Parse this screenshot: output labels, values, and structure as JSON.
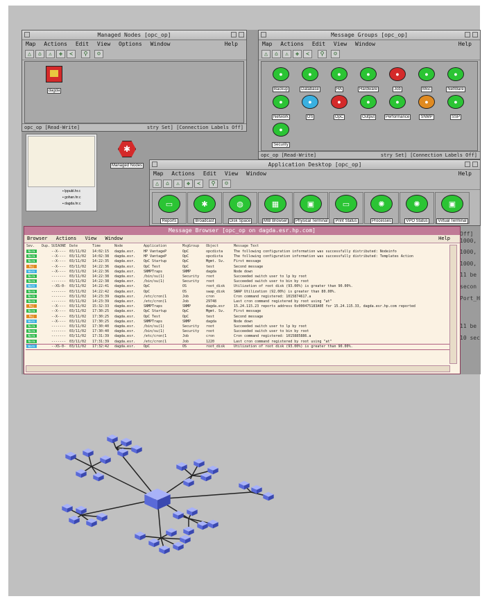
{
  "managed_nodes": {
    "title": "Managed Nodes [opc_op]",
    "menu": [
      "Map",
      "Actions",
      "Edit",
      "View",
      "Options",
      "Window"
    ],
    "help": "Help",
    "node_label": "dagda",
    "status_left": "opc_op [Read-Write]",
    "status_right": "stry Set] [Connection Labels Off]"
  },
  "message_groups": {
    "title": "Message Groups [opc_op]",
    "menu": [
      "Map",
      "Actions",
      "Edit",
      "View",
      "Window"
    ],
    "help": "Help",
    "groups": [
      {
        "label": "Backup",
        "color": "#2bc434"
      },
      {
        "label": "Database",
        "color": "#2bc434"
      },
      {
        "label": "HA",
        "color": "#2bc434"
      },
      {
        "label": "Hardware",
        "color": "#2bc434"
      },
      {
        "label": "Job",
        "color": "#d42a2a"
      },
      {
        "label": "Misc",
        "color": "#2bc434"
      },
      {
        "label": "NetWare",
        "color": "#2bc434"
      },
      {
        "label": "Network",
        "color": "#2bc434"
      },
      {
        "label": "OS",
        "color": "#3ab0e0"
      },
      {
        "label": "OpC",
        "color": "#d42a2a"
      },
      {
        "label": "Output",
        "color": "#2bc434"
      },
      {
        "label": "Performance",
        "color": "#2bc434"
      },
      {
        "label": "SNMP",
        "color": "#e08a20"
      },
      {
        "label": "SSP",
        "color": "#2bc434"
      },
      {
        "label": "Security",
        "color": "#2bc434"
      }
    ],
    "status_left": "opc_op [Read-Write]",
    "status_right": "stry Set] [Connection Labels Off]"
  },
  "side_panel": {
    "items": [
      "lppubl.hr.c",
      "gohan.hr.c",
      "dagda.hr.c"
    ],
    "managed_nodes_label": "Managed Nodes"
  },
  "app_desktop": {
    "title": "Application Desktop [opc_op]",
    "menu": [
      "Map",
      "Actions",
      "Edit",
      "View",
      "Window"
    ],
    "help": "Help",
    "apps": [
      "Reports",
      "Broadcast",
      "Disk Space",
      "MIB Browser",
      "Physical Terminal",
      "Print Status",
      "Processes",
      "VPO Status",
      "Virtual Terminal"
    ]
  },
  "message_browser": {
    "title": "Message Browser  [opc_op on dagda.esr.hp.com]",
    "menu": [
      "Browser",
      "Actions",
      "View",
      "Window"
    ],
    "help": "Help",
    "columns": [
      "Sev.",
      "Dup.",
      "SUIAONE",
      "Date",
      "Time",
      "Node",
      "Application",
      "MsgGroup",
      "Object",
      "Message Text"
    ],
    "rows": [
      {
        "sev": "Norm",
        "dup": "",
        "flags": "--X----",
        "date": "03/11/02",
        "time": "14:02:15",
        "node": "dagda.esr.",
        "app": "HP VantageP",
        "group": "OpC",
        "object": "opcdista",
        "text": "The following configuration information was successfully distributed:          Nodeinfo"
      },
      {
        "sev": "Norm",
        "dup": "",
        "flags": "--X----",
        "date": "03/11/02",
        "time": "14:02:38",
        "node": "dagda.esr.",
        "app": "HP VantageP",
        "group": "OpC",
        "object": "opcdista",
        "text": "The following configuration information was successfully distributed: Templates  Action"
      },
      {
        "sev": "Norm",
        "dup": "",
        "flags": "--X----",
        "date": "03/11/02",
        "time": "14:22:35",
        "node": "dagda.esr.",
        "app": "OpC Startup",
        "group": "OpC",
        "object": "Mgmt. Sv.",
        "text": "First message"
      },
      {
        "sev": "Maj",
        "dup": "",
        "flags": "--X----",
        "date": "03/11/02",
        "time": "14:22:36",
        "node": "dagda.esr.",
        "app": "OpC Test",
        "group": "OpC",
        "object": "test",
        "text": "Second message"
      },
      {
        "sev": "Warn",
        "dup": "",
        "flags": "--X----",
        "date": "03/11/02",
        "time": "14:22:36",
        "node": "dagda.esr.",
        "app": "SNMPTraps",
        "group": "SNMP",
        "object": "dagda",
        "text": "Node down"
      },
      {
        "sev": "Norm",
        "dup": "",
        "flags": "-------",
        "date": "03/11/02",
        "time": "14:22:38",
        "node": "dagda.esr.",
        "app": "/bin/su(1)",
        "group": "Security",
        "object": "root",
        "text": "Succeeded switch user to lp by root"
      },
      {
        "sev": "Norm",
        "dup": "",
        "flags": "-------",
        "date": "03/11/02",
        "time": "14:22:38",
        "node": "dagda.esr.",
        "app": "/bin/su(1)",
        "group": "Security",
        "object": "root",
        "text": "Succeeded switch user to bin by root"
      },
      {
        "sev": "Warn",
        "dup": "",
        "flags": "--XS-0-",
        "date": "03/11/02",
        "time": "14:22:41",
        "node": "dagda.esr.",
        "app": "OpC",
        "group": "OS",
        "object": "root_disk",
        "text": "Utilization of root disk (93.00%) is greater than 90.00%."
      },
      {
        "sev": "Norm",
        "dup": "",
        "flags": "-------",
        "date": "03/11/02",
        "time": "14:22:42",
        "node": "dagda.esr.",
        "app": "OpC",
        "group": "OS",
        "object": "swap_disk",
        "text": "SWAP Utilization (92.00%) is greater than 80.00%."
      },
      {
        "sev": "Norm",
        "dup": "",
        "flags": "-------",
        "date": "03/11/02",
        "time": "14:23:39",
        "node": "dagda.esr.",
        "app": "/etc/cron(1",
        "group": "Job",
        "object": "cron",
        "text": "Cron command registered: 1015874617.a"
      },
      {
        "sev": "Norm",
        "dup": "",
        "flags": "-------",
        "date": "03/11/02",
        "time": "14:23:39",
        "node": "dagda.esr.",
        "app": "/etc/cron(1",
        "group": "Job",
        "object": "29748",
        "text": "Last cron command registered by root using \"at\""
      },
      {
        "sev": "Maj",
        "dup": "",
        "flags": "--X----",
        "date": "03/11/02",
        "time": "15:32:33",
        "node": "dagda.esr.",
        "app": "SNMPTraps",
        "group": "SNMP",
        "object": "dagda.esr",
        "text": "15.24.115.23 reports address 0x000475183A0E for 15.24.115.33, dagda.esr.hp.com reported"
      },
      {
        "sev": "Norm",
        "dup": "",
        "flags": "--X----",
        "date": "03/11/02",
        "time": "17:30:25",
        "node": "dagda.esr.",
        "app": "OpC Startup",
        "group": "OpC",
        "object": "Mgmt. Sv.",
        "text": "First message"
      },
      {
        "sev": "Maj",
        "dup": "",
        "flags": "--X----",
        "date": "03/11/02",
        "time": "17:30:25",
        "node": "dagda.esr.",
        "app": "OpC Test",
        "group": "OpC",
        "object": "test",
        "text": "Second message"
      },
      {
        "sev": "Warn",
        "dup": "",
        "flags": "--X----",
        "date": "03/11/02",
        "time": "17:30:25",
        "node": "dagda.esr.",
        "app": "SNMPTraps",
        "group": "SNMP",
        "object": "dagda",
        "text": "Node down"
      },
      {
        "sev": "Norm",
        "dup": "",
        "flags": "-------",
        "date": "03/11/02",
        "time": "17:30:40",
        "node": "dagda.esr.",
        "app": "/bin/su(1)",
        "group": "Security",
        "object": "root",
        "text": "Succeeded switch user to lp by root"
      },
      {
        "sev": "Norm",
        "dup": "",
        "flags": "-------",
        "date": "03/11/02",
        "time": "17:30:40",
        "node": "dagda.esr.",
        "app": "/bin/su(1)",
        "group": "Security",
        "object": "root",
        "text": "Succeeded switch user to bin by root"
      },
      {
        "sev": "Norm",
        "dup": "",
        "flags": "-------",
        "date": "03/11/02",
        "time": "17:31:39",
        "node": "dagda.esr.",
        "app": "/etc/cron(1",
        "group": "Job",
        "object": "cron",
        "text": "Cron command registered: 1015885886.a"
      },
      {
        "sev": "Norm",
        "dup": "",
        "flags": "-------",
        "date": "03/11/02",
        "time": "17:31:39",
        "node": "dagda.esr.",
        "app": "/etc/cron(1",
        "group": "Job",
        "object": "1220",
        "text": "Last cron command registered by root using \"at\""
      },
      {
        "sev": "Warn",
        "dup": "",
        "flags": "--XS-0-",
        "date": "03/11/02",
        "time": "17:32:42",
        "node": "dagda.esr.",
        "app": "OpC",
        "group": "OS",
        "object": "root_disk",
        "text": "Utilization of root disk (93.00%) is greater than 90.00%."
      }
    ],
    "severity_colors": {
      "Norm": "#2bb84a",
      "Warn": "#3ab0e0",
      "Maj": "#e08a20"
    }
  },
  "right_edge_text": [
    "Off]",
    "1000,",
    "1000,",
    "1000,",
    "11 be",
    "secon",
    "Port_H",
    "11 be",
    "10 sec"
  ]
}
